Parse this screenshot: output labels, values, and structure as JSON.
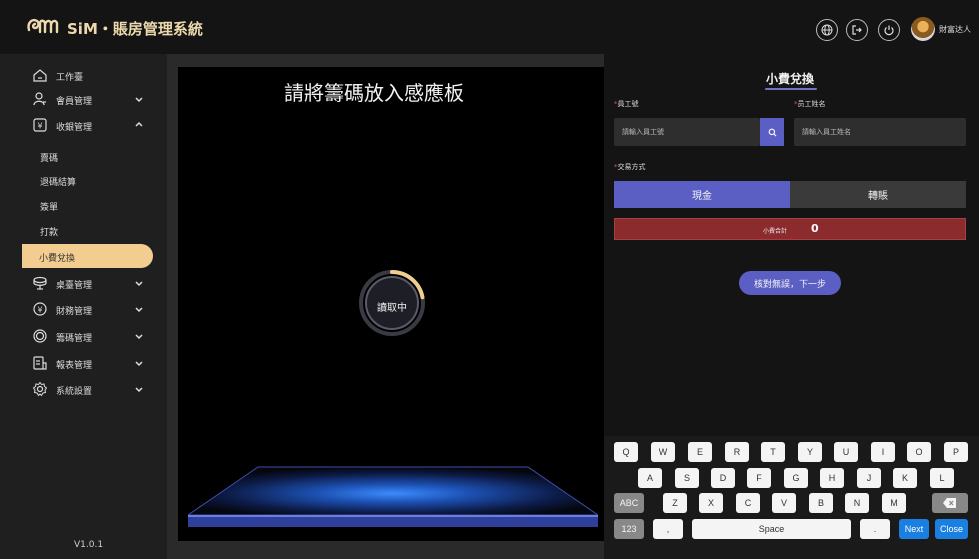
{
  "header": {
    "app_title": "SiM・賬房管理系統",
    "user_name": "財富达人",
    "icons": [
      "globe-icon",
      "logout-icon",
      "power-icon"
    ]
  },
  "sidebar": {
    "items": [
      {
        "label": "工作臺",
        "icon": "home-icon"
      },
      {
        "label": "會員管理",
        "icon": "user-icon",
        "chevron": "down"
      },
      {
        "label": "收銀管理",
        "icon": "cashier-icon",
        "chevron": "up"
      },
      {
        "label": "桌臺管理",
        "icon": "table-icon",
        "chevron": "down"
      },
      {
        "label": "財務管理",
        "icon": "yen-icon",
        "chevron": "down"
      },
      {
        "label": "籌碼管理",
        "icon": "chip-icon",
        "chevron": "down"
      },
      {
        "label": "報表管理",
        "icon": "report-icon",
        "chevron": "down"
      },
      {
        "label": "系統設置",
        "icon": "settings-icon",
        "chevron": "down"
      }
    ],
    "sub_items": [
      "賣碼",
      "退碼結算",
      "簽單",
      "打款"
    ],
    "active_sub_item": "小費兌換",
    "version": "V1.0.1"
  },
  "reader": {
    "prompt": "請將籌碼放入感應板",
    "status": "讀取中",
    "progress": 0.22
  },
  "form": {
    "title": "小費兌換",
    "employee_id_label": "員工號",
    "employee_id_placeholder": "請輸入員工號",
    "employee_name_label": "员工姓名",
    "employee_name_placeholder": "請輸入員工姓名",
    "payment_label": "交易方式",
    "payment_options": [
      "現金",
      "轉賬"
    ],
    "payment_selected": "現金",
    "tip_total_label": "小費合計",
    "tip_total_value": "0",
    "confirm_button": "核對無誤，下一步"
  },
  "keyboard": {
    "row1": [
      "Q",
      "W",
      "E",
      "R",
      "T",
      "Y",
      "U",
      "I",
      "O",
      "P"
    ],
    "row2": [
      "A",
      "S",
      "D",
      "F",
      "G",
      "H",
      "J",
      "K",
      "L"
    ],
    "row3": [
      "ABC",
      "Z",
      "X",
      "C",
      "V",
      "B",
      "N",
      "M"
    ],
    "row4": {
      "num": "123",
      "comma": ",",
      "space": "Space",
      "period": ".",
      "next": "Next",
      "close": "Close"
    }
  },
  "colors": {
    "accent": "#5b5fc4",
    "gold": "#f3cd8f",
    "alert": "#8c2b2e",
    "key_blue": "#1a7fe0"
  }
}
